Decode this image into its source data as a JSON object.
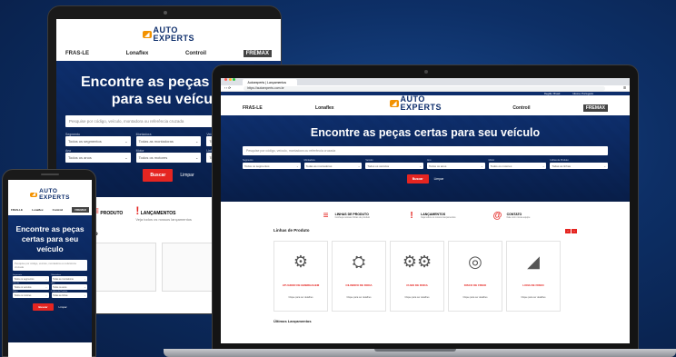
{
  "site": {
    "logo_top": "AUTO",
    "logo_bottom": "EXPERTS",
    "brands": [
      "FRAS-LE",
      "Lonaflex",
      "Controil",
      "FREMAX"
    ],
    "hero_title": "Encontre as peças certas para seu veículo",
    "search_placeholder": "Pesquise por código, veículo, montadora ou referência cruzada",
    "filter_labels": [
      "Segmento",
      "Montadora",
      "Veículo",
      "Ano",
      "Motor",
      "Linhas de Produto"
    ],
    "filter_values": [
      "Todos os segmentos",
      "Todas as montadoras",
      "Todos os veículos",
      "Todos os anos",
      "Todos os motores",
      "Todas as linhas"
    ],
    "search_button": "Buscar",
    "clear_link": "Limpar",
    "features": [
      {
        "title": "LINHAS DE PRODUTO",
        "sub": "Conheça nossas linhas de produto"
      },
      {
        "title": "LANÇAMENTOS",
        "sub": "Veja todos os nossos lançamentos"
      },
      {
        "title": "CONTATO",
        "sub": "Fale com nossa equipe"
      }
    ],
    "product_lines_title": "Linhas de Produto",
    "products": [
      {
        "name": "ATUADOR DE EMBREAGEM",
        "cta": "Clique para ver detalhes"
      },
      {
        "name": "CILINDRO DE RODA",
        "cta": "Clique para ver detalhes"
      },
      {
        "name": "CUBO DE RODA",
        "cta": "Clique para ver detalhes"
      },
      {
        "name": "DISCO DE FREIO",
        "cta": "Clique para ver detalhes"
      },
      {
        "name": "LONA DE FREIO",
        "cta": "Clique para ver detalhes"
      }
    ],
    "latest_title": "Últimos Lançamentos"
  },
  "browser": {
    "tab_title": "Autoexperts | Lançamentos",
    "url": "https://autoexperts.com.br",
    "region": "Região: Brasil",
    "language": "Idioma: Português"
  },
  "tablet": {
    "feature_1": "PRODUTO",
    "feature_2": "LANÇAMENTOS",
    "feature_2_sub": "Veja todos os nossos lançamentos",
    "section": "to"
  },
  "colors": {
    "navy": "#0d2d6b",
    "orange": "#f39200",
    "red": "#e52521"
  }
}
